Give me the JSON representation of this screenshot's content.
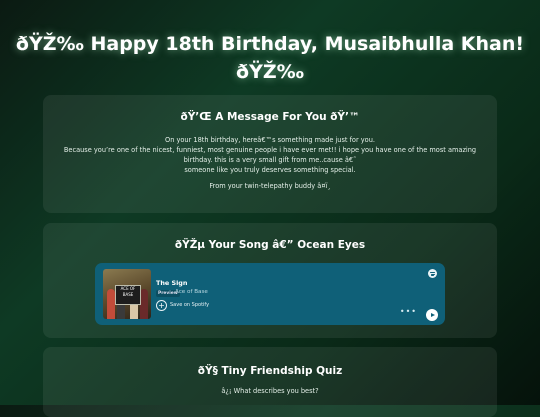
{
  "page": {
    "title_line1": "ðŸŽ‰ Happy 18th Birthday, Musaibhulla Khan!",
    "title_line2": "ðŸŽ‰"
  },
  "message_card": {
    "title": "ðŸ’Œ A Message For You ðŸ’™",
    "lines": [
      "On your 18th birthday, hereâ€™s something made just for you.",
      "Because you’re one of the nicest, funniest, most genuine people i have ever met!! i hope you have one of the most amazing",
      "birthday. this is a very small gift from me..cause â€˜",
      "someone like you truly deserves something special."
    ],
    "signoff": "From your twin-telepathy buddy â¤ï¸"
  },
  "song_card": {
    "title": "ðŸŽµ Your Song â€” Ocean Eyes",
    "player": {
      "track": "The Sign",
      "badge": "Preview",
      "artist": "Ace of Base",
      "save_label": "Save on Spotify",
      "album_text": "ACE OF BASE",
      "dots": "•••"
    }
  },
  "quiz_card": {
    "title": "ðŸ§  Tiny Friendship Quiz",
    "question": "â¿¡ What describes you best?"
  },
  "colors": {
    "player_bg": "#0f6078",
    "page_bg": "#0e3a24"
  }
}
